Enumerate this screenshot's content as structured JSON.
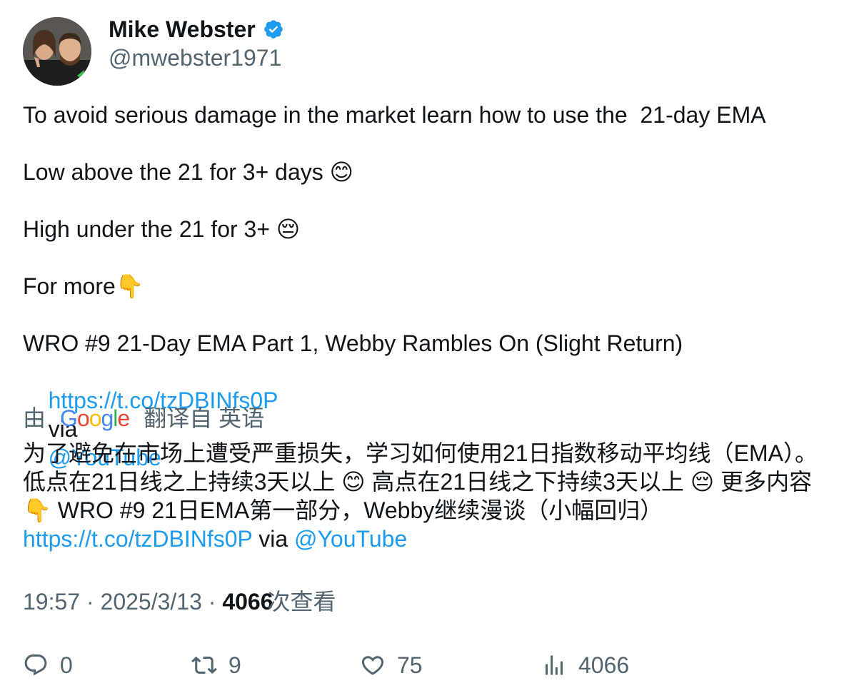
{
  "author": {
    "name": "Mike Webster",
    "handle": "@mwebster1971",
    "avatar_icon": "avatar-photo",
    "verified_icon": "verified-badge-icon"
  },
  "tweet": {
    "line1": "To avoid serious damage in the market learn how to use the  21-day EMA",
    "line2": "Low above the 21 for 3+ days 😊",
    "line3": "High under the 21 for 3+ 😔",
    "line4": "For more👇",
    "line5": "WRO #9 21-Day EMA Part 1, Webby Rambles On (Slight Return)",
    "link": "https://t.co/tzDBINfs0P",
    "via": "via",
    "mention": "@YouTube"
  },
  "translation": {
    "prefix": "由",
    "brand": "Google",
    "suffix": "翻译自 英语",
    "text": "为了避免在市场上遭受严重损失，学习如何使用21日指数移动平均线（EMA）。低点在21日线之上持续3天以上 😊 高点在21日线之下持续3天以上 😔 更多内容👇 WRO #9 21日EMA第一部分，Webby继续漫谈（小幅回归）",
    "link": "https://t.co/tzDBINfs0P",
    "via": "via",
    "mention": "@YouTube"
  },
  "meta": {
    "time": "19:57",
    "date": "2025/3/13",
    "views": "4066",
    "views_label": "次查看",
    "separator": "·"
  },
  "actions": {
    "replies": "0",
    "reposts": "9",
    "likes": "75",
    "views": "4066"
  },
  "colors": {
    "link": "#1d9bf0",
    "secondary": "#536471",
    "primary": "#0f1419"
  }
}
